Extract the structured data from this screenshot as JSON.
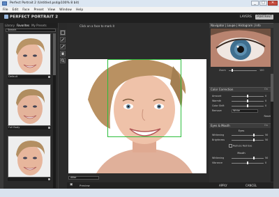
{
  "window": {
    "title": "Perfect Portrait 2 (Untitled.psd@100% 8 bit)",
    "buttons": [
      "_",
      "□",
      "✕"
    ]
  },
  "menu": [
    "File",
    "Edit",
    "Face",
    "Preset",
    "View",
    "Window",
    "Help"
  ],
  "header": {
    "logo": "PERFECT PORTRAIT 2",
    "layers": "LAYERS",
    "portrait": "PORTRAIT"
  },
  "left": {
    "tabs": [
      "Library",
      "Favorites",
      "My Presets"
    ],
    "preset_select": "Search",
    "presets": [
      "Default",
      "Full Body",
      ""
    ]
  },
  "center": {
    "hint": "Click on a face to mark it",
    "view": "After",
    "preview": "Preview"
  },
  "right": {
    "navigator_tabs": "Navigator | Loupe | Histogram | Info",
    "zoom": {
      "label": "Zoom",
      "value": "100"
    },
    "color_correction": {
      "title": "Color Correction",
      "on": "On",
      "sliders": [
        {
          "label": "Amount",
          "value": "0",
          "level": 0.5
        },
        {
          "label": "Warmth",
          "value": "0",
          "level": 0.5
        },
        {
          "label": "Color Shift",
          "value": "0",
          "level": 0.5
        },
        {
          "label": "Remove",
          "value": ""
        }
      ],
      "remove_select": "White",
      "reset": "Reset"
    },
    "eyes_mouth": {
      "title": "Eyes & Mouth",
      "on": "On",
      "eyes_label": "Eyes",
      "sliders_eyes": [
        {
          "label": "Whitening",
          "value": "50",
          "level": 0.7
        },
        {
          "label": "Brightness",
          "value": "50",
          "level": 0.7
        }
      ],
      "reduce_red_eye": "Reduce Red Eye",
      "mouth_label": "Mouth",
      "sliders_mouth": [
        {
          "label": "Whitening",
          "value": "50",
          "level": 0.7
        },
        {
          "label": "Vibrance",
          "value": "0",
          "level": 0.5
        }
      ]
    },
    "apply": "APPLY",
    "cancel": "CANCEL"
  },
  "colors": {
    "face_box": "#2bbd3b",
    "panel_bg": "#2f2f2f"
  }
}
